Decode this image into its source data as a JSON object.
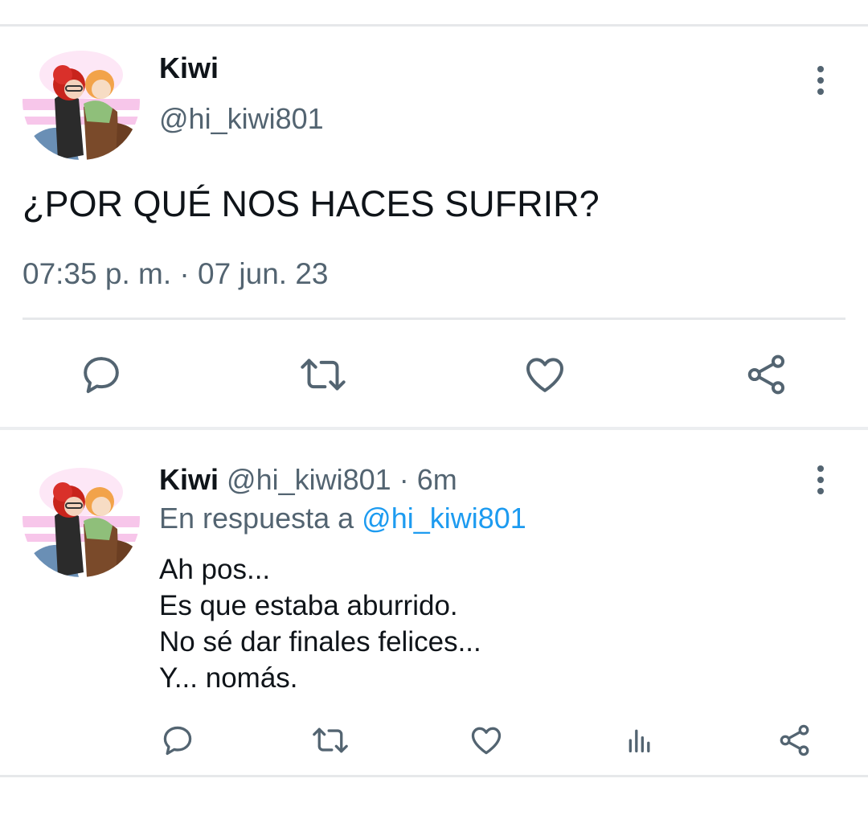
{
  "main_tweet": {
    "display_name": "Kiwi",
    "handle": "@hi_kiwi801",
    "text": "¿POR QUÉ NOS HACES SUFRIR?",
    "timestamp": "07:35 p. m. · 07 jun. 23",
    "actions": [
      "reply-icon",
      "retweet-icon",
      "like-icon",
      "share-icon"
    ]
  },
  "reply_tweet": {
    "display_name": "Kiwi",
    "handle": "@hi_kiwi801",
    "age": "· 6m",
    "in_reply_prefix": "En respuesta a",
    "in_reply_handle": "@hi_kiwi801",
    "lines": [
      "Ah pos...",
      "Es que estaba aburrido.",
      "No sé dar finales felices...",
      "Y... nomás."
    ],
    "actions": [
      "reply-icon",
      "retweet-icon",
      "like-icon",
      "analytics-icon",
      "share-icon"
    ]
  },
  "colors": {
    "text": "#0f1419",
    "muted": "#536471",
    "link": "#1d9bf0",
    "divider": "#e6e8ea"
  }
}
